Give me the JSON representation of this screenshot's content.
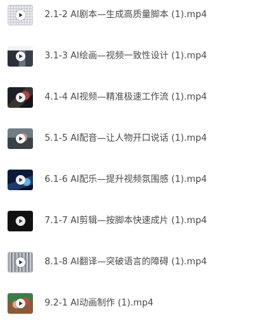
{
  "files": [
    {
      "name": "2.1-2 AI剧本—生成高质量脚本 (1).mp4",
      "thumbnail_icon": "video-thumbnail-loading"
    },
    {
      "name": "3.1-3 AI绘画—视频一致性设计 (1).mp4",
      "thumbnail_icon": "video-thumbnail"
    },
    {
      "name": "4.1-4 AI视频—精准极速工作流 (1).mp4",
      "thumbnail_icon": "video-thumbnail"
    },
    {
      "name": "5.1-5 AI配音—让人物开口说话 (1).mp4",
      "thumbnail_icon": "video-thumbnail"
    },
    {
      "name": "6.1-6 AI配乐—提升视频氛围感 (1).mp4",
      "thumbnail_icon": "video-thumbnail"
    },
    {
      "name": "7.1-7 AI剪辑—按脚本快速成片 (1).mp4",
      "thumbnail_icon": "video-thumbnail"
    },
    {
      "name": "8.1-8 AI翻译—突破语言的障碍 (1).mp4",
      "thumbnail_icon": "video-thumbnail"
    },
    {
      "name": "9.2-1 AI动画制作 (1).mp4",
      "thumbnail_icon": "video-thumbnail"
    }
  ]
}
